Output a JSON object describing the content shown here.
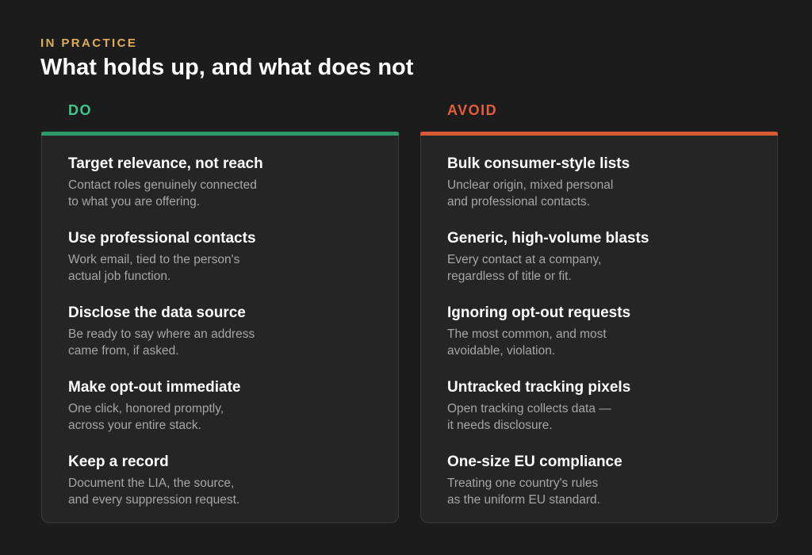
{
  "header": {
    "eyebrow": "IN PRACTICE",
    "title": "What holds up, and what does not"
  },
  "colors": {
    "background": "#1c1c1c",
    "card": "#252525",
    "eyebrow": "#e0ad58",
    "do_accent": "#3fc68c",
    "avoid_accent": "#e35f3a"
  },
  "do": {
    "heading": "DO",
    "items": [
      {
        "title": "Target relevance, not reach",
        "desc": "Contact roles genuinely connected\nto what you are offering."
      },
      {
        "title": "Use professional contacts",
        "desc": "Work email, tied to the person's\nactual job function."
      },
      {
        "title": "Disclose the data source",
        "desc": "Be ready to say where an address\ncame from, if asked."
      },
      {
        "title": "Make opt-out immediate",
        "desc": "One click, honored promptly,\nacross your entire stack."
      },
      {
        "title": "Keep a record",
        "desc": "Document the LIA, the source,\nand every suppression request."
      }
    ]
  },
  "avoid": {
    "heading": "AVOID",
    "items": [
      {
        "title": "Bulk consumer-style lists",
        "desc": "Unclear origin, mixed personal\nand professional contacts."
      },
      {
        "title": "Generic, high-volume blasts",
        "desc": "Every contact at a company,\nregardless of title or fit."
      },
      {
        "title": "Ignoring opt-out requests",
        "desc": "The most common, and most\navoidable, violation."
      },
      {
        "title": "Untracked tracking pixels",
        "desc": "Open tracking collects data —\nit needs disclosure."
      },
      {
        "title": "One-size EU compliance",
        "desc": "Treating one country's rules\nas the uniform EU standard."
      }
    ]
  }
}
